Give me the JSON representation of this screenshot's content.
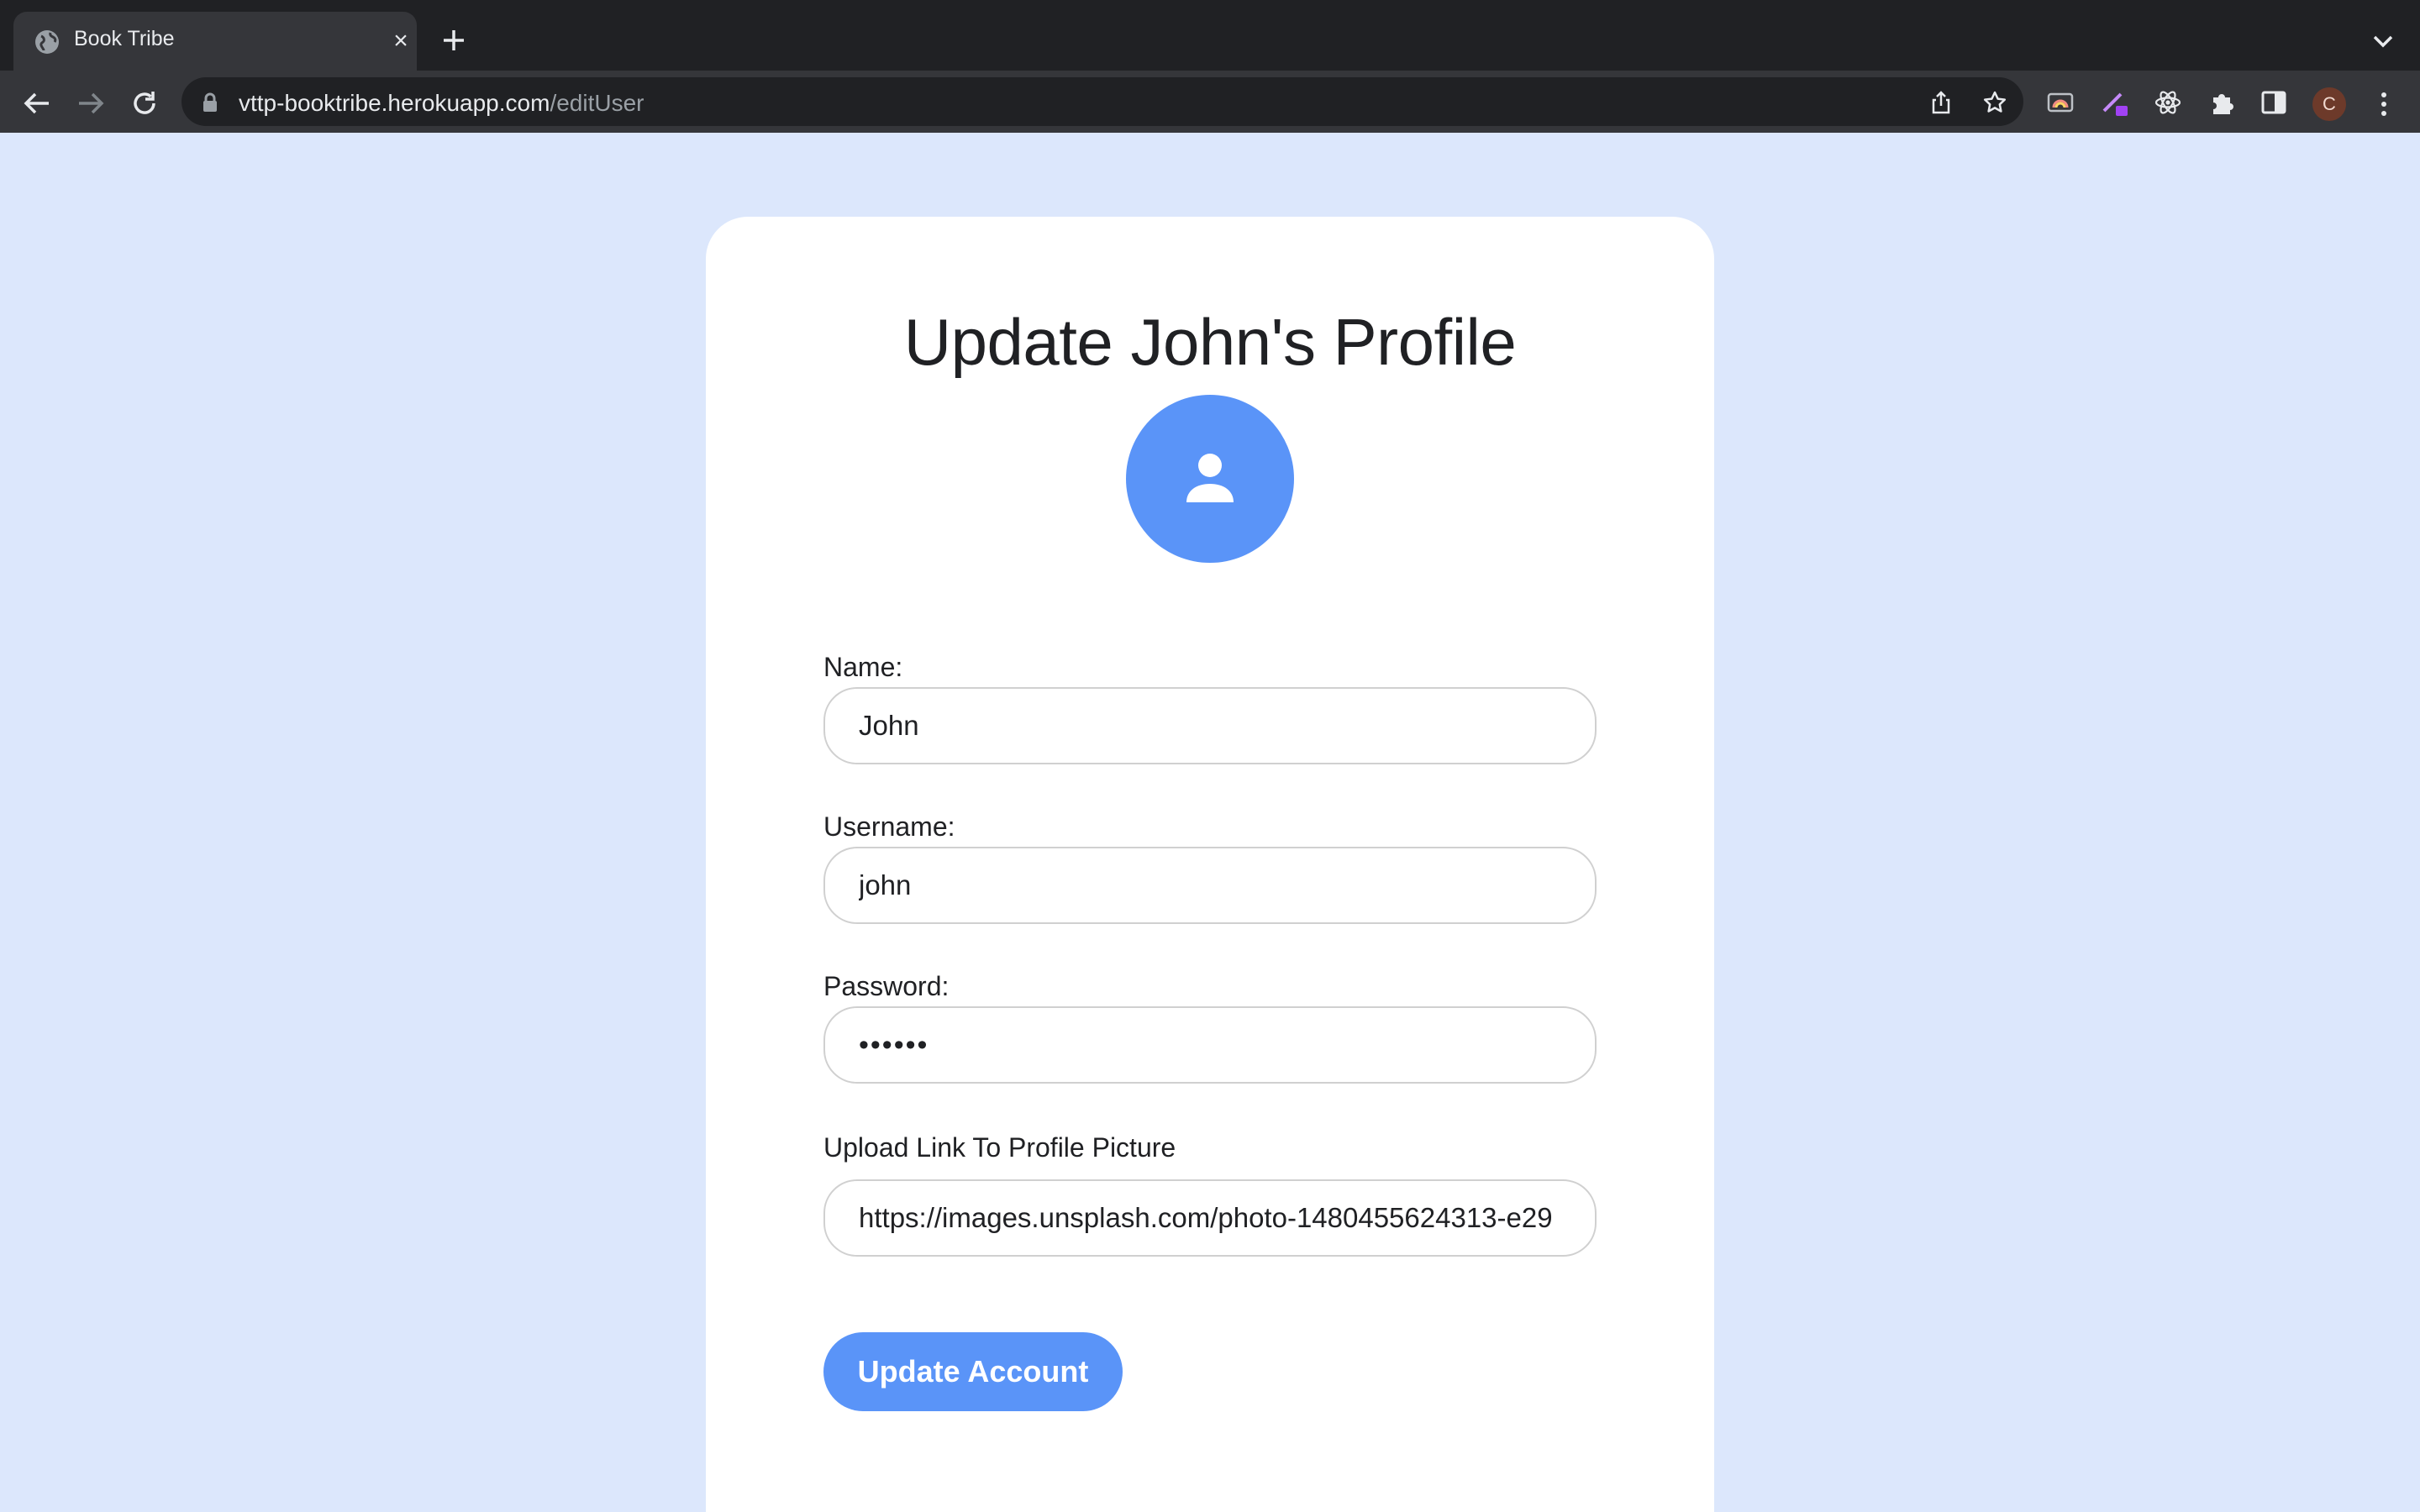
{
  "browser": {
    "tab_title": "Book Tribe",
    "url_host": "vttp-booktribe.herokuapp.com",
    "url_path": "/editUser",
    "profile_initial": "C"
  },
  "page": {
    "title": "Update John's Profile",
    "accent_color": "#5a94f8",
    "background_color": "#dce7fc"
  },
  "form": {
    "name_label": "Name:",
    "name_value": "John",
    "username_label": "Username:",
    "username_value": "john",
    "password_label": "Password:",
    "password_value": "••••••",
    "picture_label": "Upload Link To Profile Picture",
    "picture_value": "https://images.unsplash.com/photo-1480455624313-e29",
    "submit_label": "Update Account"
  }
}
